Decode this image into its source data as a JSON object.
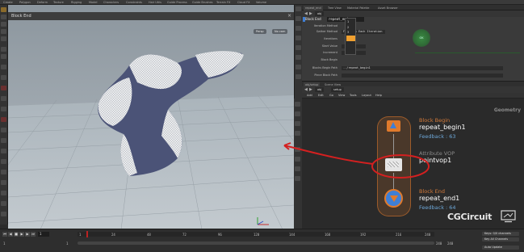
{
  "desk_tabs": [
    "Create",
    "Polygon",
    "Deform",
    "Texture",
    "Rigging",
    "Model",
    "Characters",
    "Constraints",
    "Hair Utils",
    "Guide Process",
    "Guide Brushes",
    "Terrain FX",
    "Cloud FX",
    "Volume"
  ],
  "viewport": {
    "title": "Block End",
    "persp_label": "Persp",
    "camera_label": "No cam"
  },
  "param_editor": {
    "tabs": [
      "repeat_end",
      "Tree View",
      "Material Palette",
      "Asset Browser"
    ],
    "path": "obj",
    "node_type": "Block End",
    "node_name": "repeat_end",
    "rows": [
      {
        "label": "Iteration Method",
        "value": ""
      },
      {
        "label": "Gather Method",
        "value": "Feedback Each Iteration"
      },
      {
        "label": "Iterations",
        "value": ""
      },
      {
        "label": "Start Value",
        "value": ""
      },
      {
        "label": "Increment",
        "value": ""
      },
      {
        "label": "Block Begin",
        "value": ""
      },
      {
        "label": "Blocks Begin Path",
        "value": "../repeat_begin1"
      },
      {
        "label": "Piece Block Path",
        "value": ""
      }
    ],
    "dropdown_options": [
      "1",
      "2",
      "3"
    ],
    "compile_label": "OK"
  },
  "network_editor": {
    "tabs": [
      "obj/setup",
      "Scene View"
    ],
    "path": [
      "obj",
      "setup"
    ],
    "menu": [
      "Add",
      "Edit",
      "Go",
      "View",
      "Tools",
      "Layout",
      "Help"
    ],
    "context_label": "Geometry",
    "nodes": [
      {
        "label": "Block Begin",
        "name": "repeat_begin1",
        "feedback": "Feedback : 63"
      },
      {
        "label": "Attribute VOP",
        "name": "pointvop1",
        "feedback": ""
      },
      {
        "label": "Block End",
        "name": "repeat_end1",
        "feedback": "Feedback : 64"
      }
    ],
    "annotation_color": "#d42020"
  },
  "timeline": {
    "current_frame": "1",
    "start": "1",
    "end": "240",
    "end2": "240",
    "ticks": [
      "1",
      "24",
      "48",
      "72",
      "96",
      "120",
      "144",
      "168",
      "192",
      "216",
      "240"
    ],
    "right_buttons": [
      "Keys: 0/0 channels",
      "Key All Channels",
      "Auto Update"
    ]
  },
  "brand": "CGCircuit",
  "colors": {
    "node_orange": "#e07a2c",
    "node_blue": "#3f7fd6",
    "label_orange": "#d37a3a",
    "feedback_blue": "#6da7d8",
    "network_bg": "#2a2a2a",
    "viewport_bg": "#9fa7ae"
  }
}
